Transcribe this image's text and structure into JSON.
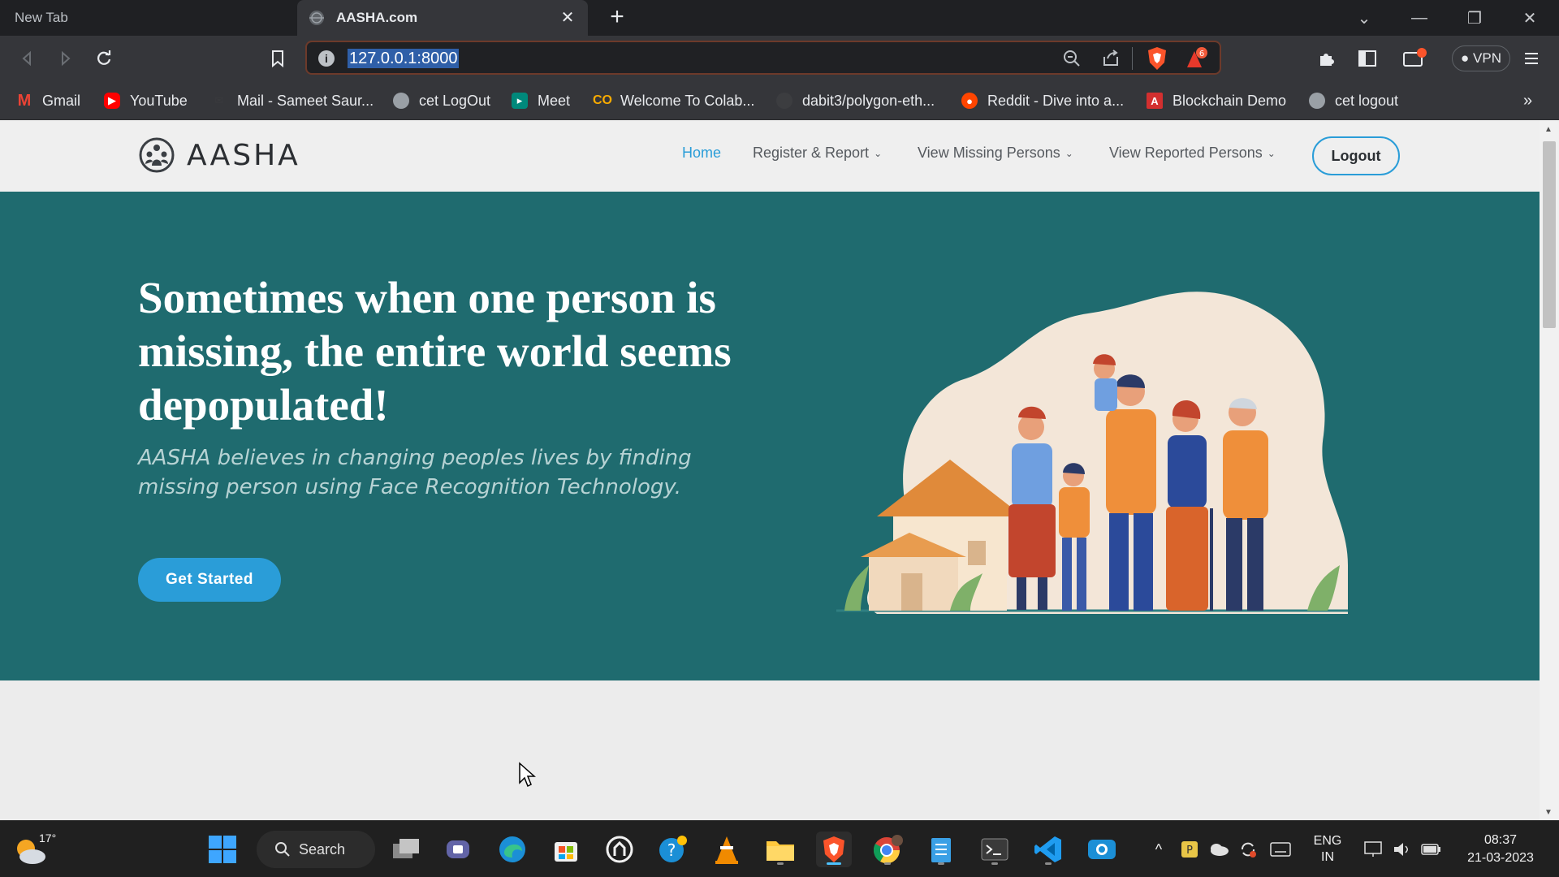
{
  "browser": {
    "tabs": [
      {
        "label": "New Tab",
        "active": false
      },
      {
        "label": "AASHA.com",
        "active": true
      }
    ],
    "url": "127.0.0.1:8000",
    "vpn_label": "VPN",
    "brave_badge_count": "6",
    "bookmarks": [
      {
        "label": "Gmail",
        "icon": "gmail-icon"
      },
      {
        "label": "YouTube",
        "icon": "youtube-icon"
      },
      {
        "label": "Mail - Sameet Saur...",
        "icon": "mail-icon"
      },
      {
        "label": "cet LogOut",
        "icon": "globe-icon"
      },
      {
        "label": "Meet",
        "icon": "meet-icon"
      },
      {
        "label": "Welcome To Colab...",
        "icon": "colab-icon"
      },
      {
        "label": "dabit3/polygon-eth...",
        "icon": "github-icon"
      },
      {
        "label": "Reddit - Dive into a...",
        "icon": "reddit-icon"
      },
      {
        "label": "Blockchain Demo",
        "icon": "blockchain-demo-icon"
      },
      {
        "label": "cet logout",
        "icon": "globe-icon"
      }
    ],
    "bookmarks_overflow": "»"
  },
  "site": {
    "brand": "AASHA",
    "nav": {
      "home": "Home",
      "register_report": "Register & Report",
      "view_missing": "View Missing Persons",
      "view_reported": "View Reported Persons",
      "logout": "Logout"
    },
    "hero": {
      "title": "Sometimes when one person is missing, the entire world seems depopulated!",
      "subtitle": "AASHA believes in changing peoples lives by finding missing person using Face Recognition Technology.",
      "cta": "Get Started"
    },
    "colors": {
      "hero_bg": "#1f6b6f",
      "accent": "#2a9dd8",
      "navbar_bg": "#efefef"
    }
  },
  "taskbar": {
    "weather_temp": "17°",
    "search_label": "Search",
    "language": "ENG",
    "region": "IN",
    "time": "08:37",
    "date": "21-03-2023"
  }
}
